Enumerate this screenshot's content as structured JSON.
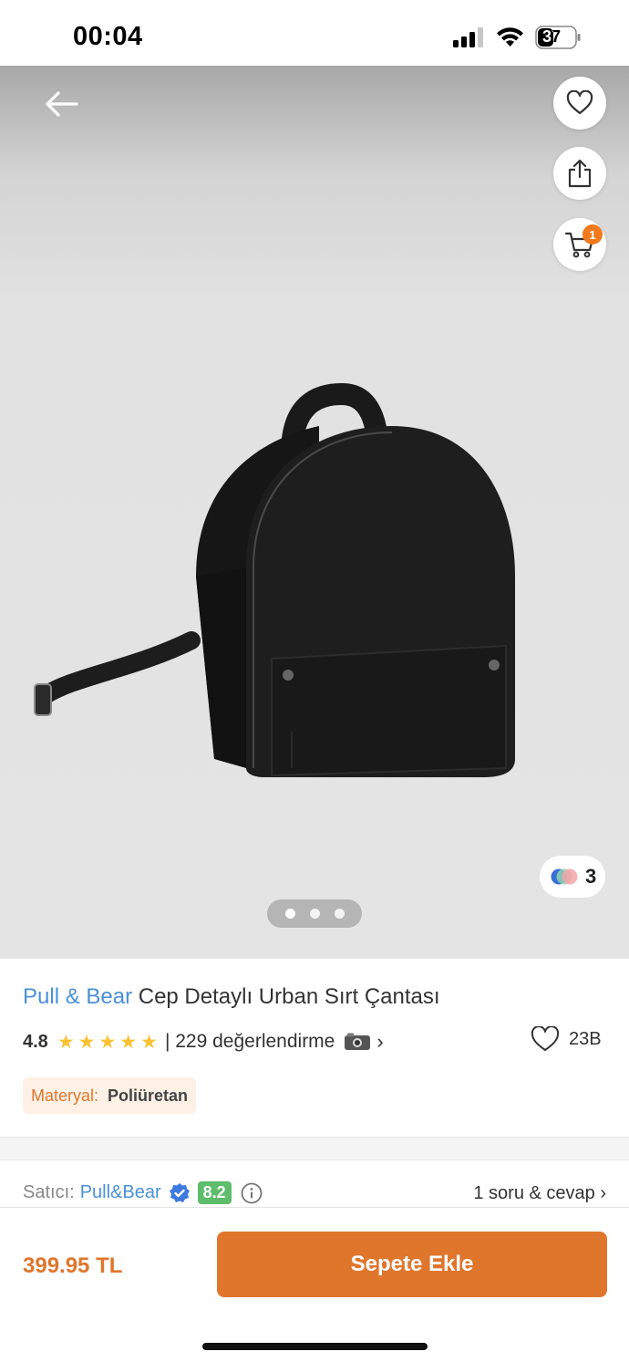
{
  "status_bar": {
    "time": "00:04",
    "battery": "37"
  },
  "gallery": {
    "color_count": "3",
    "image_count": 3,
    "active_index": 0
  },
  "header": {
    "cart_badge": "1"
  },
  "product": {
    "brand": "Pull & Bear",
    "name": "Cep Detaylı Urban Sırt Çantası",
    "rating": "4.8",
    "stars": 5,
    "review_text": "| 229 değerlendirme",
    "likes": "23B",
    "material_label": "Materyal:",
    "material_value": "Poliüretan"
  },
  "seller": {
    "label": "Satıcı:",
    "name": "Pull&Bear",
    "score": "8.2",
    "qa_text": "1 soru & cevap ›"
  },
  "bottom": {
    "price": "399.95 TL",
    "button_label": "Sepete Ekle"
  },
  "colors": {
    "accent": "#e0762c",
    "brand_link": "#4a90d9",
    "badge": "#f27a1a",
    "score_green": "#5ebd6a",
    "star": "#f8c232"
  }
}
